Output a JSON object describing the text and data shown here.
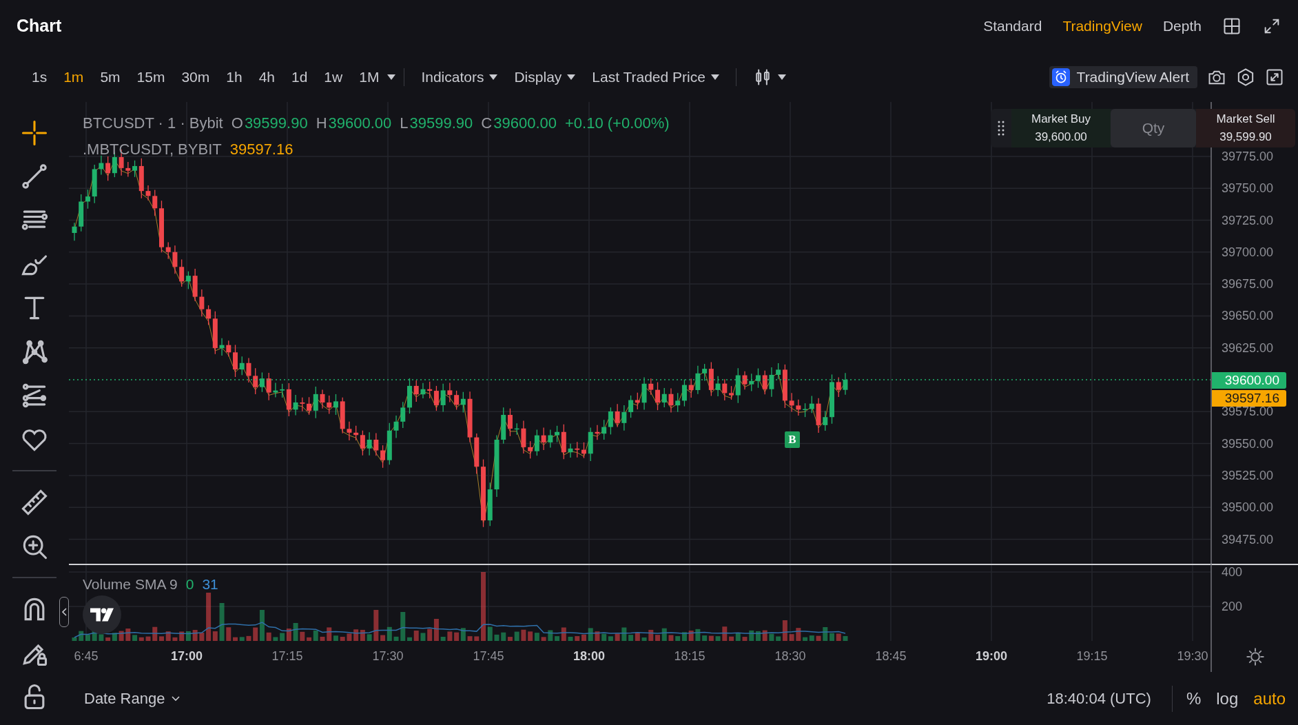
{
  "header": {
    "title": "Chart",
    "views": [
      {
        "label": "Standard",
        "selected": false
      },
      {
        "label": "TradingView",
        "selected": true
      },
      {
        "label": "Depth",
        "selected": false
      }
    ]
  },
  "toolbar": {
    "intervals": [
      {
        "label": "1s",
        "selected": false
      },
      {
        "label": "1m",
        "selected": true
      },
      {
        "label": "5m",
        "selected": false
      },
      {
        "label": "15m",
        "selected": false
      },
      {
        "label": "30m",
        "selected": false
      },
      {
        "label": "1h",
        "selected": false
      },
      {
        "label": "4h",
        "selected": false
      },
      {
        "label": "1d",
        "selected": false
      },
      {
        "label": "1w",
        "selected": false
      },
      {
        "label": "1M",
        "selected": false
      }
    ],
    "menus": [
      "Indicators",
      "Display",
      "Last Traded Price"
    ],
    "alert_button": "TradingView Alert"
  },
  "tools": [
    {
      "kind": "crosshair",
      "selected": true
    },
    {
      "kind": "trendline",
      "selected": false
    },
    {
      "kind": "lines",
      "selected": false
    },
    {
      "kind": "brush",
      "selected": false
    },
    {
      "kind": "text",
      "selected": false
    },
    {
      "kind": "pattern",
      "selected": false
    },
    {
      "kind": "fib",
      "selected": false
    },
    {
      "kind": "heart",
      "selected": false
    },
    {
      "kind": "divider"
    },
    {
      "kind": "ruler",
      "selected": false
    },
    {
      "kind": "zoom",
      "selected": false
    },
    {
      "kind": "divider"
    },
    {
      "kind": "magnet",
      "selected": false
    },
    {
      "kind": "pencil-lock",
      "selected": false
    },
    {
      "kind": "lock",
      "selected": false
    }
  ],
  "legend": {
    "symbol_line": "BTCUSDT · 1 · Bybit",
    "ohlc": [
      {
        "key": "O",
        "value": "39599.90"
      },
      {
        "key": "H",
        "value": "39600.00"
      },
      {
        "key": "L",
        "value": "39599.90"
      },
      {
        "key": "C",
        "value": "39600.00"
      }
    ],
    "change": "+0.10 (+0.00%)",
    "index_symbol": ".MBTCUSDT, BYBIT",
    "index_value": "39597.16"
  },
  "trade_panel": {
    "buy_label": "Market Buy",
    "buy_price": "39,600.00",
    "qty_placeholder": "Qty",
    "sell_label": "Market Sell",
    "sell_price": "39,599.90"
  },
  "price_axis": {
    "labels": [
      "39775.00",
      "39750.00",
      "39725.00",
      "39700.00",
      "39675.00",
      "39650.00",
      "39625.00",
      "39575.00",
      "39550.00",
      "39525.00",
      "39500.00",
      "39475.00"
    ],
    "last_price": "39600.00",
    "index_price": "39597.16"
  },
  "trade_marker": "B",
  "volume": {
    "title": "Volume SMA 9",
    "value": "0",
    "sma": "31",
    "axis_labels": [
      "400",
      "200"
    ]
  },
  "time_axis": {
    "labels": [
      {
        "text": "6:45",
        "bold": false
      },
      {
        "text": "17:00",
        "bold": true
      },
      {
        "text": "17:15",
        "bold": false
      },
      {
        "text": "17:30",
        "bold": false
      },
      {
        "text": "17:45",
        "bold": false
      },
      {
        "text": "18:00",
        "bold": true
      },
      {
        "text": "18:15",
        "bold": false
      },
      {
        "text": "18:30",
        "bold": false
      },
      {
        "text": "18:45",
        "bold": false
      },
      {
        "text": "19:00",
        "bold": true
      },
      {
        "text": "19:15",
        "bold": false
      },
      {
        "text": "19:30",
        "bold": false
      }
    ]
  },
  "footer": {
    "date_range": "Date Range",
    "clock": "18:40:04 (UTC)",
    "scale_options": [
      {
        "label": "%",
        "selected": false
      },
      {
        "label": "log",
        "selected": false
      },
      {
        "label": "auto",
        "selected": true
      }
    ]
  }
}
